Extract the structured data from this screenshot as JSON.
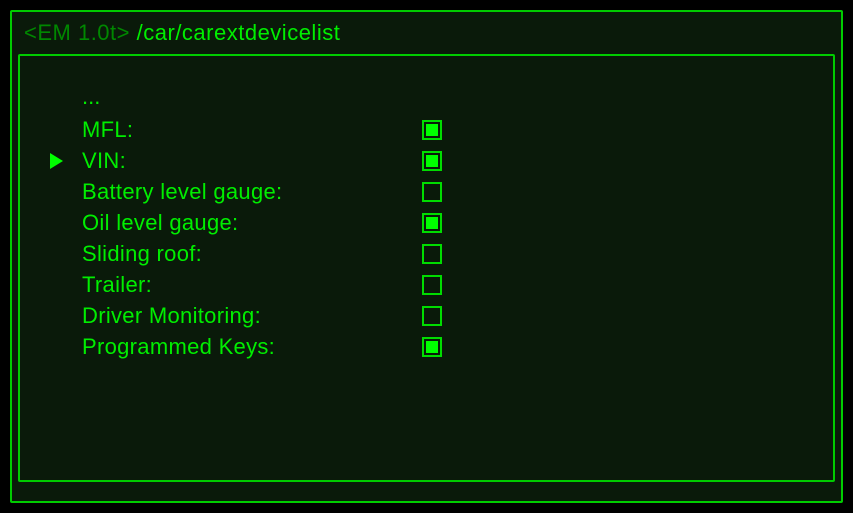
{
  "header": {
    "prefix": "<EM 1.0t>",
    "path": "/car/carextdevicelist"
  },
  "ellipsis": "...",
  "items": [
    {
      "label": "MFL:",
      "checked": true,
      "selected": false
    },
    {
      "label": "VIN:",
      "checked": true,
      "selected": true
    },
    {
      "label": "Battery level gauge:",
      "checked": false,
      "selected": false
    },
    {
      "label": "Oil level gauge:",
      "checked": true,
      "selected": false
    },
    {
      "label": "Sliding roof:",
      "checked": false,
      "selected": false
    },
    {
      "label": "Trailer:",
      "checked": false,
      "selected": false
    },
    {
      "label": "Driver Monitoring:",
      "checked": false,
      "selected": false
    },
    {
      "label": "Programmed Keys:",
      "checked": true,
      "selected": false
    }
  ]
}
